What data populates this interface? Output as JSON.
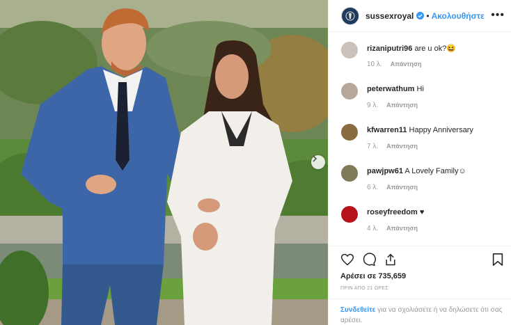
{
  "post": {
    "username": "sussexroyal",
    "follow_label": "Ακολουθήστε",
    "dot": "•",
    "more_icon": "more-horizontal-icon",
    "accent": "#3897f0"
  },
  "comments": [
    {
      "user": "rizaniputri96",
      "text": "are u ok?😆",
      "age": "10 λ.",
      "reply": "Απάντηση",
      "avatar_color": "#c9c2bd"
    },
    {
      "user": "peterwathum",
      "text": "Hi",
      "age": "9 λ.",
      "reply": "Απάντηση",
      "avatar_color": "#b7a79a"
    },
    {
      "user": "kfwarren11",
      "text": "Happy Anniversary",
      "age": "7 λ.",
      "reply": "Απάντηση",
      "avatar_color": "#8a6a3f"
    },
    {
      "user": "pawjpw61",
      "text": "A Lovely Family☺",
      "age": "6 λ.",
      "reply": "Απάντηση",
      "avatar_color": "#7f7a5a"
    },
    {
      "user": "roseyfreedom",
      "text": "♥",
      "age": "4 λ.",
      "reply": "Απάντηση",
      "avatar_color": "#b5121b"
    }
  ],
  "stats": {
    "likes": "Αρέσει σε 735,659",
    "posted": "ΠΡΙΝ ΑΠΟ 21 ΩΡΕΣ"
  },
  "login": {
    "link": "Συνδεθείτε",
    "rest": " για να σχολιάσετε ή να δηλώσετε ότι σας αρέσει."
  }
}
